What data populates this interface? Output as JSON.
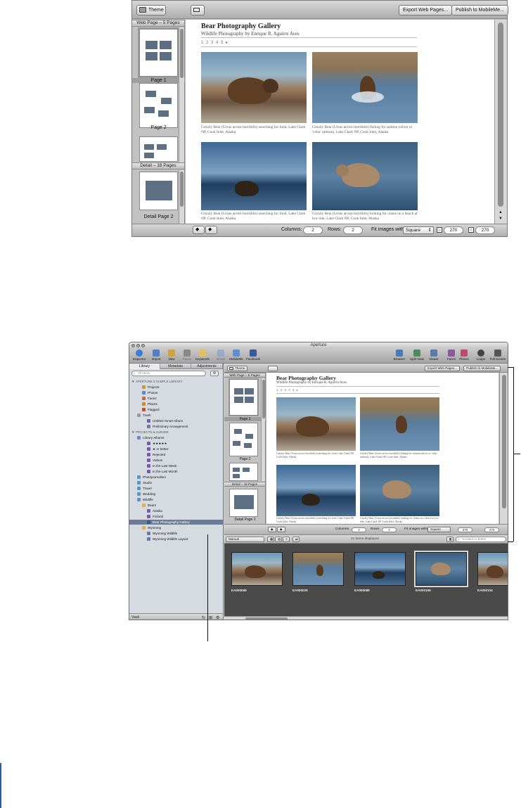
{
  "toolbar": {
    "theme_label": "Theme",
    "export_label": "Export Web Pages...",
    "publish_label": "Publish to MobileMe..."
  },
  "sidebar": {
    "web_section": "Web Page – 5 Pages",
    "detail_section": "Detail – 18 Pages",
    "pages": [
      "Page 1",
      "Page 2"
    ],
    "detail_pages": [
      "Detail Page 2"
    ]
  },
  "gallery": {
    "title": "Bear Photography Gallery",
    "subtitle": "Wildlife Photography by  Enrique R. Aguirre Aves",
    "page_nav": "1 2 3 4 5 ▸",
    "captions": [
      "Grizzly Bear (Ursus arctos horribilis) searching for food, Lake Clark NP, Cook Inlet, Alaska",
      "Grizzly Bear (Ursus arctos horribilis) fishing for salmon (silver or 'coho' salmon), Lake Clark NP, Cook Inlet, Alaska",
      "Grizzly Bear (Ursus arctos horribilis) searching for food, Lake Clark NP, Cook Inlet, Alaska",
      "Grizzly Bear (Ursus arctos horribilis) looking for clams on a beach at low tide, Lake Clark NP, Cook Inlet, Alaska"
    ]
  },
  "bottom_bar": {
    "columns_label": "Columns:",
    "columns_value": "2",
    "rows_label": "Rows:",
    "rows_value": "2",
    "fit_label": "Fit images within:",
    "fit_value": "Square",
    "width_value": "270",
    "height_value": "270"
  },
  "window": {
    "title": "Aperture",
    "tools_left": [
      "Inspector",
      "Import",
      "New",
      "Faces",
      "Keywords"
    ],
    "tools_mid": [
      "Email",
      "MobileMe",
      "Facebook"
    ],
    "tools_right": [
      "Browser",
      "Split View",
      "Viewer",
      "Faces",
      "Places",
      "Loupe",
      "Full Screen"
    ]
  },
  "library": {
    "tabs": [
      "Library",
      "Metadata",
      "Adjustments"
    ],
    "search_placeholder": "All Items",
    "rows": [
      {
        "text": "APERTURE 3 SAMPLE LIBRARY",
        "type": "hdr",
        "indent": 0
      },
      {
        "text": "Projects",
        "indent": 2,
        "color": "#c89a3c"
      },
      {
        "text": "Photos",
        "indent": 2,
        "color": "#5b85c4"
      },
      {
        "text": "Faces",
        "indent": 2,
        "color": "#c86a3c"
      },
      {
        "text": "Places",
        "indent": 2,
        "color": "#d08a2c"
      },
      {
        "text": "Flagged",
        "indent": 2,
        "color": "#d04a2c"
      },
      {
        "text": "Trash",
        "indent": 1,
        "color": "#9a9a9a"
      },
      {
        "text": "Untitled Smart Album",
        "indent": 3,
        "color": "#7a5aa8"
      },
      {
        "text": "Preliminary Arrangement",
        "indent": 3,
        "color": "#6a7aa8"
      },
      {
        "text": "PROJECTS & ALBUMS",
        "type": "hdr",
        "indent": 0
      },
      {
        "text": "Library Albums",
        "indent": 1,
        "color": "#6a8ac4"
      },
      {
        "text": "★★★★★",
        "indent": 3,
        "color": "#7a5aa8"
      },
      {
        "text": "★ or better",
        "indent": 3,
        "color": "#7a5aa8"
      },
      {
        "text": "Rejected",
        "indent": 3,
        "color": "#7a5aa8"
      },
      {
        "text": "Videos",
        "indent": 3,
        "color": "#7a5aa8"
      },
      {
        "text": "In the Last Week",
        "indent": 3,
        "color": "#7a5aa8"
      },
      {
        "text": "In the Last Month",
        "indent": 3,
        "color": "#7a5aa8"
      },
      {
        "text": "Photojournalism",
        "indent": 1,
        "color": "#5b95c4"
      },
      {
        "text": "Studio",
        "indent": 1,
        "color": "#5b95c4"
      },
      {
        "text": "Travel",
        "indent": 1,
        "color": "#5b95c4"
      },
      {
        "text": "Wedding",
        "indent": 1,
        "color": "#5b95c4"
      },
      {
        "text": "Wildlife",
        "indent": 1,
        "color": "#5b95c4"
      },
      {
        "text": "Bears",
        "indent": 2,
        "color": "#d8b44a"
      },
      {
        "text": "Alaska",
        "indent": 3,
        "color": "#7a5aa8"
      },
      {
        "text": "Finland",
        "indent": 3,
        "color": "#7a5aa8"
      },
      {
        "text": "Bear Photography Gallery",
        "indent": 3,
        "color": "#3a5a8a",
        "highlight": true
      },
      {
        "text": "Wyoming",
        "indent": 2,
        "color": "#d8b44a"
      },
      {
        "text": "Wyoming Wildlife",
        "indent": 3,
        "color": "#6a7aa8"
      },
      {
        "text": "Wyoming Wildlife Layout",
        "indent": 3,
        "color": "#6a7aa8"
      }
    ],
    "footer_label": "Vault"
  },
  "browser": {
    "sort_value": "Manual",
    "count_text": "21 items displayed",
    "search_placeholder": "Unrated or Better",
    "thumbs": [
      "EA000098",
      "EA000026",
      "EA000089",
      "EA000166",
      "EA000104"
    ]
  }
}
